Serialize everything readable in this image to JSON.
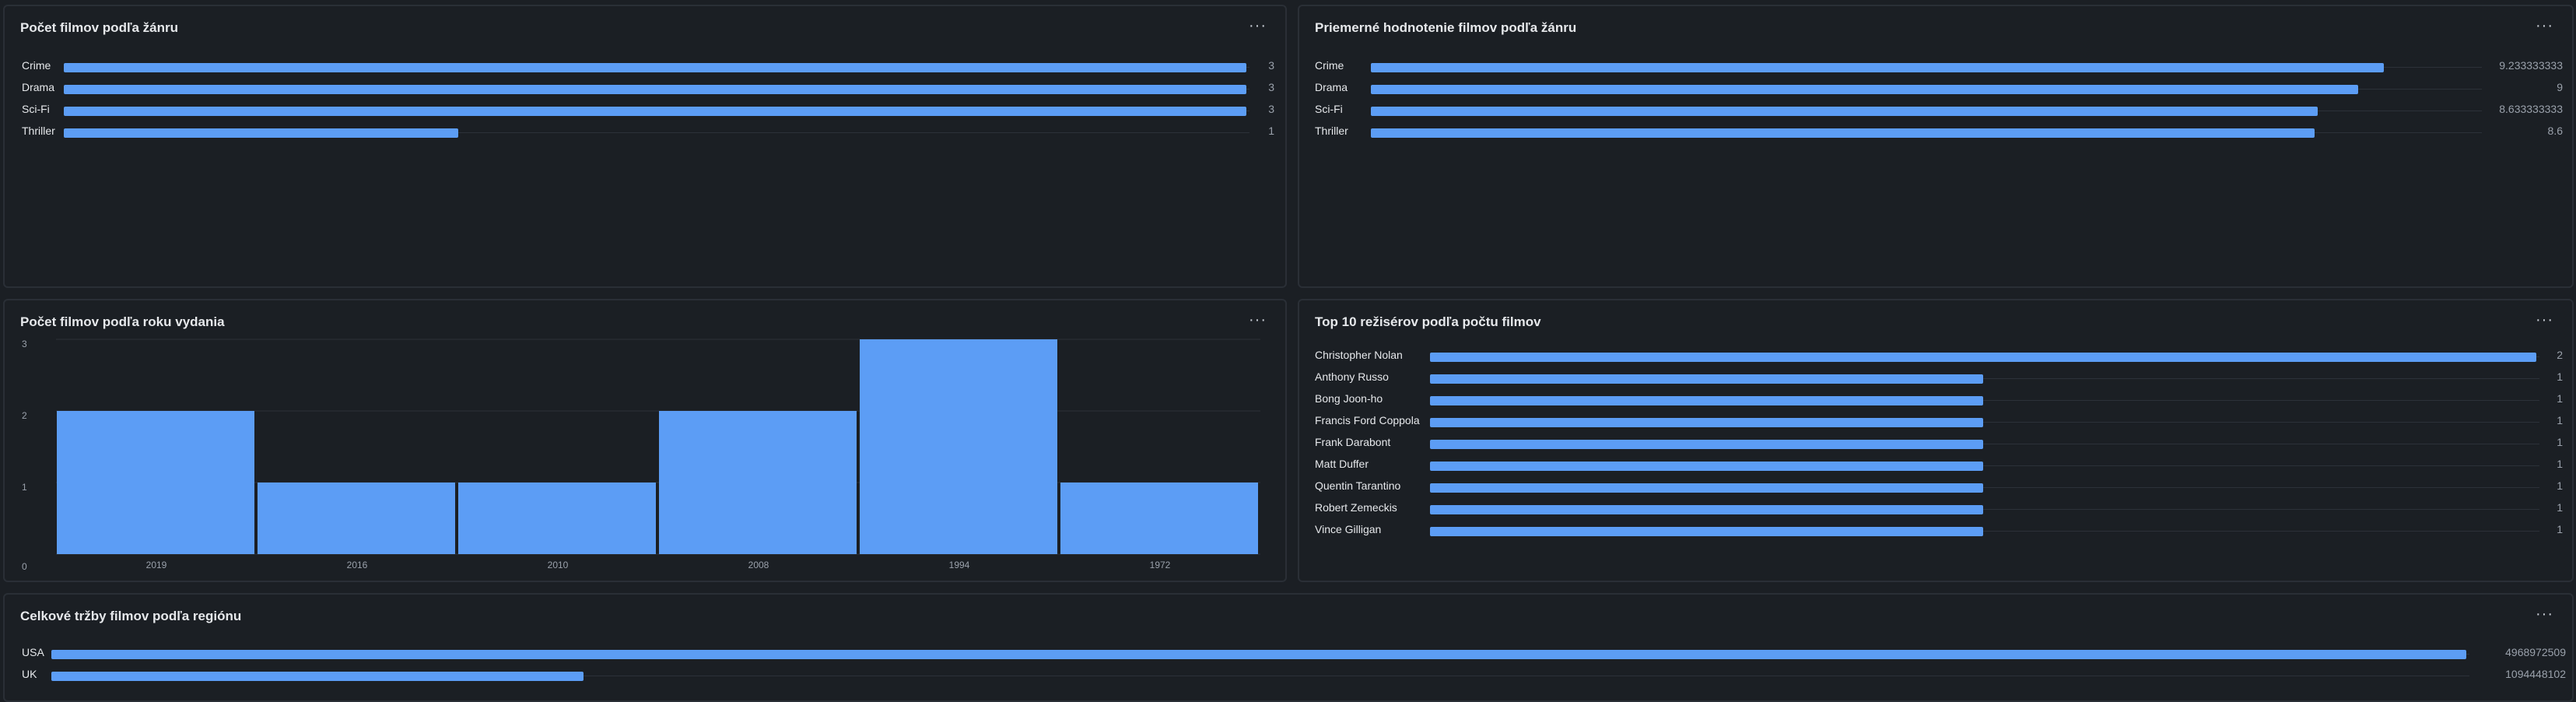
{
  "menu_icon": "more-horizontal-icon",
  "menu_glyph": "···",
  "colors": {
    "bar": "#5c9df5",
    "background": "#1b1f24",
    "grid": "#2c3139"
  },
  "panels": {
    "genre_count": {
      "title": "Počet filmov podľa žánru"
    },
    "genre_rating": {
      "title": "Priemerné hodnotenie filmov podľa žánru"
    },
    "year_count": {
      "title": "Počet filmov podľa roku vydania"
    },
    "top_directors": {
      "title": "Top 10 režisérov podľa počtu filmov"
    },
    "region_revenue": {
      "title": "Celkové tržby filmov podľa regiónu"
    }
  },
  "chart_data": [
    {
      "id": "genre_count",
      "type": "bar",
      "orientation": "horizontal",
      "title": "Počet filmov podľa žánru",
      "categories": [
        "Crime",
        "Drama",
        "Sci-Fi",
        "Thriller"
      ],
      "values": [
        3,
        3,
        3,
        1
      ],
      "value_labels": [
        "3",
        "3",
        "3",
        "1"
      ],
      "xlim": [
        0,
        3
      ]
    },
    {
      "id": "genre_rating",
      "type": "bar",
      "orientation": "horizontal",
      "title": "Priemerné hodnotenie filmov podľa žánru",
      "categories": [
        "Crime",
        "Drama",
        "Sci-Fi",
        "Thriller"
      ],
      "values": [
        9.233333333,
        9,
        8.633333333,
        8.6
      ],
      "value_labels": [
        "9.233333333",
        "9",
        "8.633333333",
        "8.6"
      ],
      "xlim": [
        0,
        10.1
      ]
    },
    {
      "id": "year_count",
      "type": "bar",
      "orientation": "vertical",
      "title": "Počet filmov podľa roku vydania",
      "categories": [
        "2019",
        "2016",
        "2010",
        "2008",
        "1994",
        "1972"
      ],
      "values": [
        2,
        1,
        1,
        2,
        3,
        1
      ],
      "yticks": [
        "0",
        "1",
        "2",
        "3"
      ],
      "ylim": [
        0,
        3
      ],
      "grid": true
    },
    {
      "id": "top_directors",
      "type": "bar",
      "orientation": "horizontal",
      "title": "Top 10 režisérov podľa počtu filmov",
      "categories": [
        "Christopher Nolan",
        "Anthony Russo",
        "Bong Joon-ho",
        "Francis Ford Coppola",
        "Frank Darabont",
        "Matt Duffer",
        "Quentin Tarantino",
        "Robert Zemeckis",
        "Vince Gilligan"
      ],
      "values": [
        2,
        1,
        1,
        1,
        1,
        1,
        1,
        1,
        1
      ],
      "value_labels": [
        "2",
        "1",
        "1",
        "1",
        "1",
        "1",
        "1",
        "1",
        "1"
      ],
      "xlim": [
        0,
        2
      ]
    },
    {
      "id": "region_revenue",
      "type": "bar",
      "orientation": "horizontal",
      "title": "Celkové tržby filmov podľa regiónu",
      "categories": [
        "USA",
        "UK"
      ],
      "values": [
        4968972509,
        1094448102
      ],
      "value_labels": [
        "4968972509",
        "1094448102"
      ],
      "xlim": [
        0,
        4968972509
      ]
    }
  ]
}
